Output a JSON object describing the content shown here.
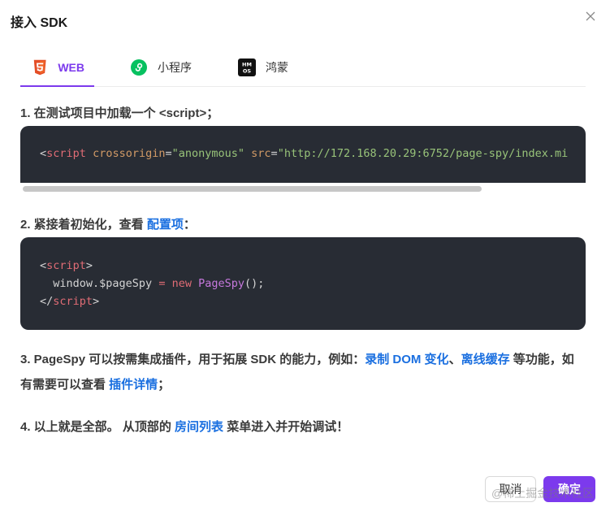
{
  "dialog": {
    "title": "接入 SDK"
  },
  "tabs": [
    {
      "label": "WEB",
      "icon": "html5-icon",
      "active": true
    },
    {
      "label": "小程序",
      "icon": "miniprogram-icon",
      "active": false
    },
    {
      "label": "鸿蒙",
      "icon": "harmonyos-icon",
      "active": false
    }
  ],
  "steps": {
    "s1": {
      "text": "1. 在测试项目中加载一个 <script>；"
    },
    "s2": {
      "prefix": "2. 紧接着初始化，查看 ",
      "link": "配置项",
      "suffix": "："
    },
    "s3": {
      "prefix": "3. PageSpy 可以按需集成插件，用于拓展 SDK 的能力，例如：",
      "link1": "录制 DOM 变化",
      "sep": "、",
      "link2": "离线缓存",
      "mid": " 等功能，如有需要可以查看 ",
      "link3": "插件详情",
      "suffix": "；"
    },
    "s4": {
      "prefix": "4. 以上就是全部。 从顶部的 ",
      "link": "房间列表",
      "suffix": " 菜单进入并开始调试！"
    }
  },
  "code1": {
    "open": "<",
    "tag": "script",
    "attr1": "crossorigin",
    "eq": "=",
    "val1": "\"anonymous\"",
    "attr2": "src",
    "val2": "\"http://172.168.20.29:6752/page-spy/index.mi"
  },
  "code2": {
    "l1_open": "<",
    "l1_tag": "script",
    "l1_close": ">",
    "l2_pre": "  window.$pageSpy ",
    "l2_eq": "=",
    "l2_new": "new",
    "l2_cls": "PageSpy",
    "l2_end": "();",
    "l3_open": "</",
    "l3_tag": "script",
    "l3_close": ">"
  },
  "footer": {
    "cancel_label": "取消",
    "ok_label": "确定"
  },
  "watermark": "@稀土掘金技术社区",
  "colors": {
    "accent": "#7c3aed",
    "link": "#1a6fe0",
    "code_bg": "#282c34"
  }
}
